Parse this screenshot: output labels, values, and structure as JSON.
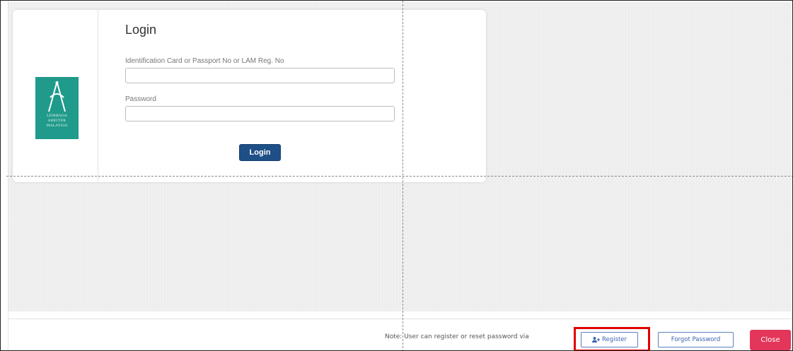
{
  "login": {
    "title": "Login",
    "id_label": "Identification Card or Passport No or LAM Reg. No",
    "id_value": "",
    "password_label": "Password",
    "password_value": "",
    "submit_label": "Login"
  },
  "logo": {
    "line1": "LEMBAGA",
    "line2": "ARKITEK",
    "line3": "MALAYSIA",
    "color": "#1f9a8b"
  },
  "footer": {
    "note": "Note: User can register or reset password via",
    "register_label": "Register",
    "register_icon": "user-plus-icon",
    "forgot_label": "Forgot Password",
    "close_label": "Close"
  },
  "colors": {
    "login_button": "#1e4f87",
    "close_button": "#e3365a",
    "outline_button": "#3b64b0",
    "highlight": "#e00000"
  }
}
